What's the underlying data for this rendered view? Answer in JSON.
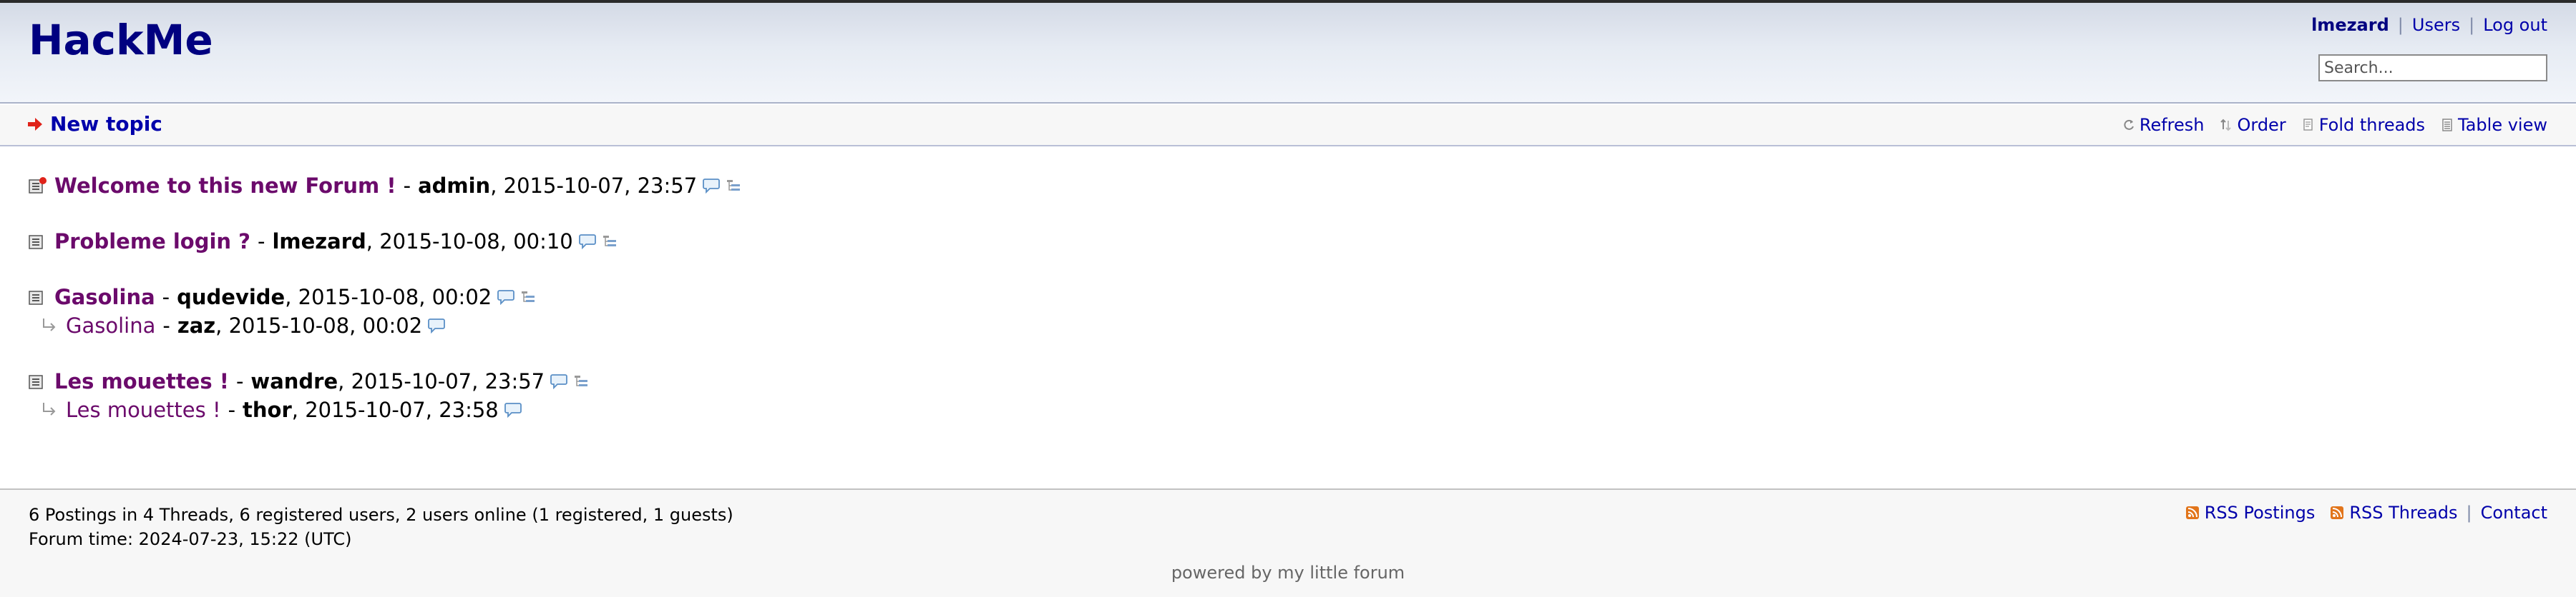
{
  "header": {
    "title": "HackMe",
    "user_nav": {
      "username": "lmezard",
      "users": "Users",
      "logout": "Log out"
    },
    "search_placeholder": "Search..."
  },
  "subnav": {
    "new_topic": "New topic",
    "options": {
      "refresh": "Refresh",
      "order": "Order",
      "fold": "Fold threads",
      "table": "Table view"
    }
  },
  "threads": [
    {
      "subject": "Welcome to this new Forum !",
      "author": "admin",
      "date": ", 2015-10-07, 23:57",
      "icon": "thread-new-icon",
      "replies": []
    },
    {
      "subject": "Probleme login ?",
      "author": "lmezard",
      "date": ", 2015-10-08, 00:10",
      "icon": "thread-icon",
      "replies": []
    },
    {
      "subject": "Gasolina",
      "author": "qudevide",
      "date": ", 2015-10-08, 00:02",
      "icon": "thread-icon",
      "replies": [
        {
          "subject": "Gasolina",
          "author": "zaz",
          "date": ", 2015-10-08, 00:02"
        }
      ]
    },
    {
      "subject": "Les mouettes !",
      "author": "wandre",
      "date": ", 2015-10-07, 23:57",
      "icon": "thread-icon",
      "replies": [
        {
          "subject": "Les mouettes !",
          "author": "thor",
          "date": ", 2015-10-07, 23:58"
        }
      ]
    }
  ],
  "separator": "-",
  "footer": {
    "stats": "6 Postings in 4 Threads, 6 registered users, 2 users online (1 registered, 1 guests)",
    "forum_time": "Forum time: 2024-07-23, 15:22 (UTC)",
    "rss_postings": "RSS Postings",
    "rss_threads": "RSS Threads",
    "contact": "Contact",
    "powered": "powered by my little forum"
  },
  "colors": {
    "link": "#0000aa",
    "title": "#000080",
    "subject": "#6b0a6b",
    "rss": "#e2751b"
  }
}
